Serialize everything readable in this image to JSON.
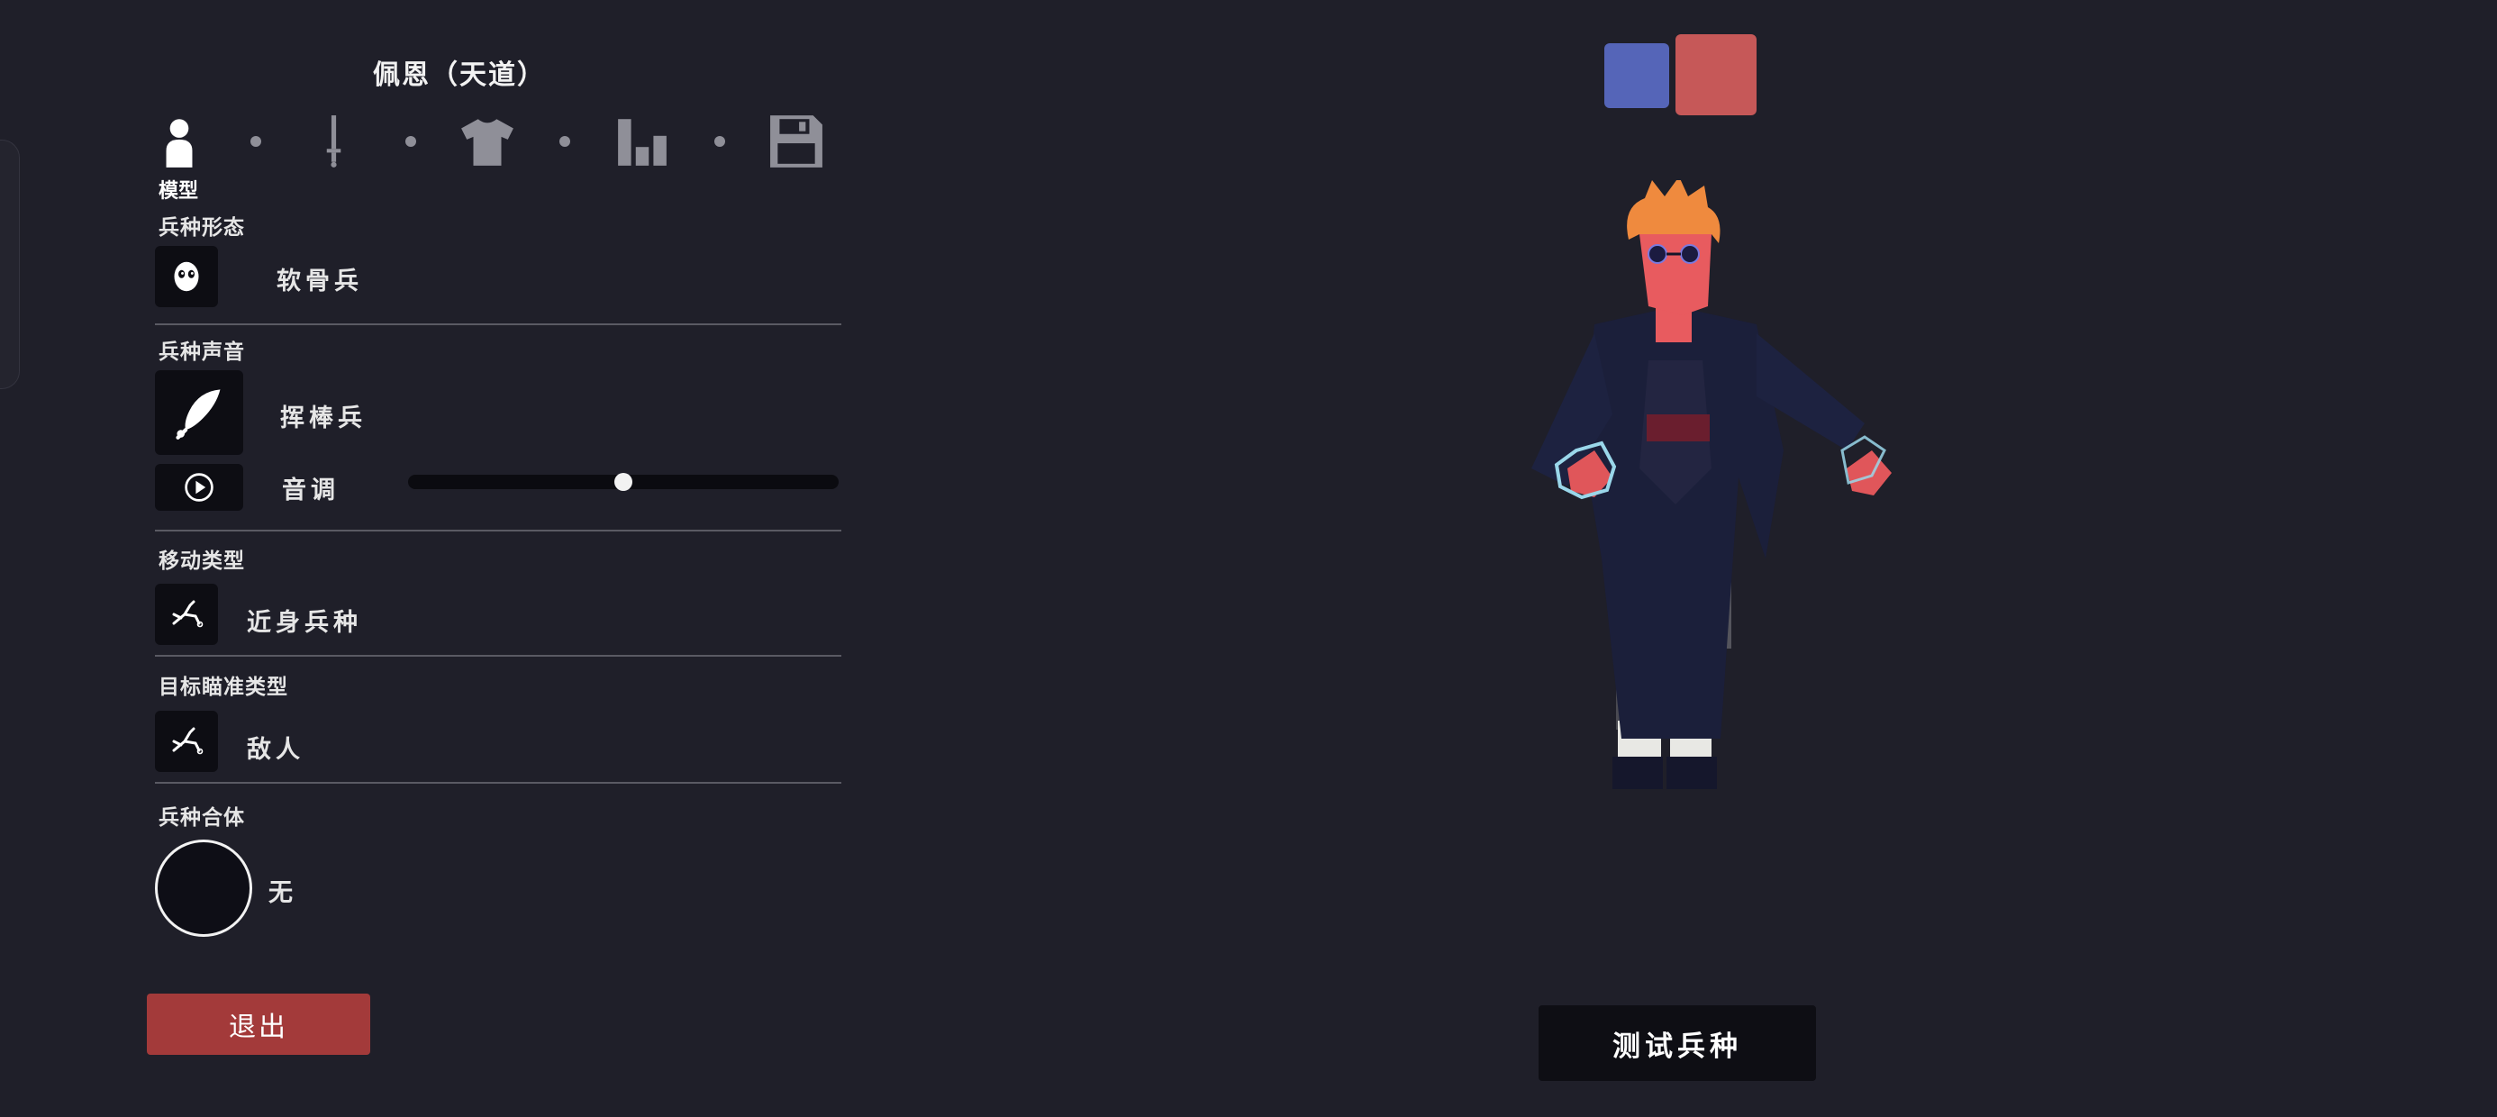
{
  "unit_name": "佩恩（天道）",
  "tabs": [
    {
      "icon": "person-icon",
      "label": "模型",
      "active": true
    },
    {
      "icon": "sword-icon",
      "label": "",
      "active": false
    },
    {
      "icon": "shirt-icon",
      "label": "",
      "active": false
    },
    {
      "icon": "bar-chart-icon",
      "label": "",
      "active": false
    },
    {
      "icon": "floppy-disk-icon",
      "label": "",
      "active": false
    }
  ],
  "sections": {
    "form": {
      "label": "兵种形态",
      "icon": "skull-mask-icon",
      "value": "软骨兵"
    },
    "voice": {
      "label": "兵种声音",
      "icon": "feather-icon",
      "value": "挥棒兵"
    },
    "pitch": {
      "icon": "play-icon",
      "label": "音调",
      "value": 0.5
    },
    "movement": {
      "label": "移动类型",
      "icon": "fallen-stickman-icon",
      "value": "近身兵种"
    },
    "targeting": {
      "label": "目标瞄准类型",
      "icon": "fallen-stickman-icon",
      "value": "敌人"
    },
    "merge": {
      "label": "兵种合体",
      "icon": "empty-circle-icon",
      "value": "无"
    }
  },
  "team_colors": {
    "blue": "#5565b8",
    "red": "#c65858",
    "selected": "red"
  },
  "buttons": {
    "exit": "退出",
    "test": "测试兵种"
  },
  "colors": {
    "background": "#1f1f29",
    "exit_button": "#a33a3a",
    "test_button": "#0e0e14"
  }
}
